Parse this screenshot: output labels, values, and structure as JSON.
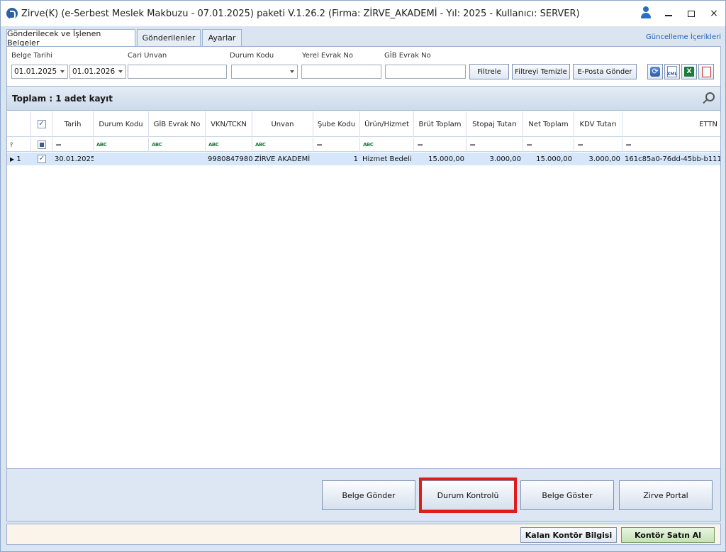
{
  "window": {
    "title": "Zirve(K)  (e-Serbest Meslek Makbuzu - 07.01.2025) paketi V.1.26.2 (Firma: ZİRVE_AKADEMİ - Yıl: 2025 - Kullanıcı: SERVER)",
    "controls": {
      "minimize": "minimize",
      "maximize": "maximize",
      "close": "×"
    }
  },
  "tabs": [
    {
      "label": "Gönderilecek ve İşlenen Belgeler",
      "active": true
    },
    {
      "label": "Gönderilenler",
      "active": false
    },
    {
      "label": "Ayarlar",
      "active": false
    }
  ],
  "update_link": "Güncelleme İçerikleri",
  "filters": {
    "belge_tarihi_label": "Belge Tarihi",
    "date_from": "01.01.2025",
    "date_to": "01.01.2026",
    "cari_unvan_label": "Cari Unvan",
    "cari_unvan_value": "",
    "durum_kodu_label": "Durum Kodu",
    "durum_kodu_value": "",
    "yerel_evrak_label": "Yerel Evrak No",
    "yerel_evrak_value": "",
    "gib_evrak_label": "GİB Evrak No",
    "gib_evrak_value": "",
    "btn_filtrele": "Filtrele",
    "btn_filtreyi_temizle": "Filtreyi Temizle",
    "btn_eposta": "E-Posta Gönder",
    "icon_xml": "XML",
    "icon_excel": "X"
  },
  "grid": {
    "title": "Toplam : 1 adet kayıt",
    "columns": [
      "Tarih",
      "Durum Kodu",
      "GİB Evrak No",
      "VKN/TCKN",
      "Unvan",
      "Şube Kodu",
      "Ürün/Hizmet",
      "Brüt Toplam",
      "Stopaj Tutarı",
      "Net Toplam",
      "KDV Tutarı",
      "ETTN"
    ],
    "filter_tokens": {
      "text": "ABC",
      "eq": "="
    },
    "rows": [
      {
        "row_no": "1",
        "checked": true,
        "tarih": "30.01.2025",
        "durum_kodu": "",
        "gib_evrak_no": "",
        "vkn": "9980847980",
        "unvan": "ZİRVE AKADEMİ",
        "sube_kodu": "1",
        "urun_hizmet": "Hizmet Bedeli",
        "brut_toplam": "15.000,00",
        "stopaj_tutari": "3.000,00",
        "net_toplam": "15.000,00",
        "kdv_tutari": "3.000,00",
        "ettn": "161c85a0-76dd-45bb-b111"
      }
    ]
  },
  "actions": {
    "belge_gonder": "Belge Gönder",
    "durum_kontrolu": "Durum Kontrolü",
    "belge_goster": "Belge Göster",
    "zirve_portal": "Zirve Portal",
    "highlighted": "durum_kontrolu",
    "highlight_color": "#e21b1b"
  },
  "status_bar": {
    "kalan_kontor": "Kalan Kontör Bilgisi",
    "kontor_satin_al": "Kontör Satın Al"
  }
}
